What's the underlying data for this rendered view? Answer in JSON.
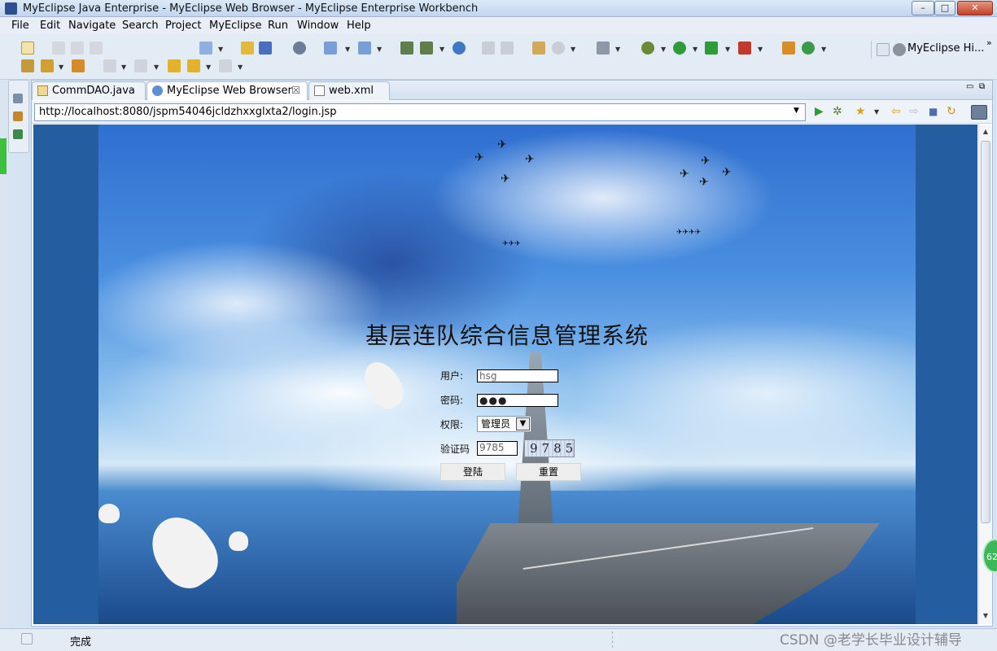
{
  "window": {
    "title": "MyEclipse Java Enterprise - MyEclipse Web Browser - MyEclipse Enterprise Workbench",
    "minimize": "–",
    "maximize": "□",
    "close": "✕"
  },
  "menu": [
    "File",
    "Edit",
    "Navigate",
    "Search",
    "Project",
    "MyEclipse",
    "Run",
    "Window",
    "Help"
  ],
  "perspective": {
    "label": "MyEclipse Hi...",
    "more": "»"
  },
  "tabs": [
    {
      "label": "CommDAO.java",
      "icon": "java-file-icon"
    },
    {
      "label": "MyEclipse Web Browser",
      "icon": "globe-icon",
      "close": "☒"
    },
    {
      "label": "web.xml",
      "icon": "xml-file-icon"
    }
  ],
  "browser": {
    "url": "http://localhost:8080/jspm54046jcldzhxxglxta2/login.jsp",
    "dropdown": "▼",
    "go": "▶",
    "back": "⇦",
    "forward": "⇨",
    "stop": "■",
    "refresh": "↻"
  },
  "page": {
    "title": "基层连队综合信息管理系统",
    "user_label": "用户:",
    "user_value": "hsg",
    "password_label": "密码:",
    "password_value": "●●●",
    "role_label": "权限:",
    "role_value": "管理员",
    "captcha_label": "验证码",
    "captcha_input": "9785",
    "captcha_image": "9785",
    "login_button": "登陆",
    "reset_button": "重置"
  },
  "status": {
    "text": "完成",
    "badge": "62"
  },
  "watermark": "CSDN @老学长毕业设计辅导"
}
